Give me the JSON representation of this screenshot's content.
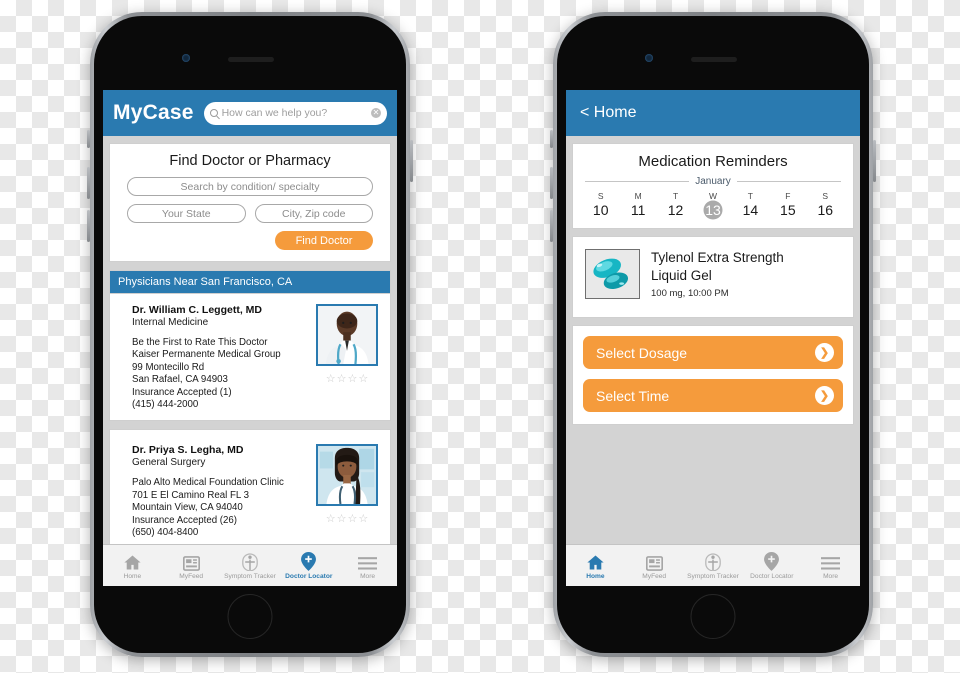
{
  "colors": {
    "brand_blue": "#2a7ab0",
    "accent_orange": "#f59b3c",
    "screen_bg": "#d3d3d3",
    "card_bg": "#ffffff",
    "muted_text": "#9a9a9a"
  },
  "left_phone": {
    "appbar": {
      "brand": "MyCase",
      "search_placeholder": "How can we help you?",
      "search_value": "",
      "search_icon": "search-icon",
      "clear_icon": "clear-icon"
    },
    "find_panel": {
      "title": "Find Doctor or Pharmacy",
      "condition_field": {
        "placeholder": "Search by condition/ specialty",
        "value": ""
      },
      "state_field": {
        "placeholder": "Your State",
        "value": ""
      },
      "zip_field": {
        "placeholder": "City, Zip code",
        "value": ""
      },
      "submit_label": "Find Doctor"
    },
    "results": {
      "banner": "Physicians Near San Francisco, CA",
      "doctors": [
        {
          "name": "Dr. William C. Leggett, MD",
          "specialty": "Internal Medicine",
          "rate_prompt": "Be the First to Rate This Doctor",
          "practice": "Kaiser Permanente Medical Group",
          "street": "99 Montecillo Rd",
          "city_state_zip": "San Rafael, CA 94903",
          "insurance": "Insurance Accepted (1)",
          "phone": "(415) 444-2000",
          "rating_stars": 0,
          "star_count": 4,
          "photo": "doctor-male-photo"
        },
        {
          "name": "Dr. Priya S. Legha, MD",
          "specialty": "General Surgery",
          "rate_prompt": "",
          "practice": "Palo Alto Medical Foundation Clinic",
          "street": "701 E El Camino Real FL 3",
          "city_state_zip": "Mountain View, CA 94040",
          "insurance": "Insurance Accepted (26)",
          "phone": "(650) 404-8400",
          "rating_stars": 0,
          "star_count": 4,
          "photo": "doctor-female-photo"
        }
      ]
    },
    "tabbar": {
      "active": "Doctor Locator",
      "items": [
        {
          "label": "Home",
          "icon": "home-icon"
        },
        {
          "label": "MyFeed",
          "icon": "feed-icon"
        },
        {
          "label": "Symptom Tracker",
          "icon": "body-icon"
        },
        {
          "label": "Doctor Locator",
          "icon": "map-pin-plus-icon"
        },
        {
          "label": "More",
          "icon": "hamburger-icon"
        }
      ]
    }
  },
  "right_phone": {
    "navbar": {
      "back_label": "< Home",
      "back_icon": "chevron-left-icon"
    },
    "reminders": {
      "title": "Medication Reminders",
      "month": "January",
      "weekday_labels": [
        "S",
        "M",
        "T",
        "W",
        "T",
        "F",
        "S"
      ],
      "days": [
        "10",
        "11",
        "12",
        "13",
        "14",
        "15",
        "16"
      ],
      "selected_day": "13"
    },
    "medication": {
      "image": "pill-capsules-photo",
      "name_line1": "Tylenol Extra Strength",
      "name_line2": "Liquid Gel",
      "details": "100 mg, 10:00 PM"
    },
    "actions": [
      {
        "label": "Select Dosage",
        "icon": "chevron-right-icon"
      },
      {
        "label": "Select Time",
        "icon": "chevron-right-icon"
      }
    ],
    "tabbar": {
      "active": "Home",
      "items": [
        {
          "label": "Home",
          "icon": "home-icon"
        },
        {
          "label": "MyFeed",
          "icon": "feed-icon"
        },
        {
          "label": "Symptom Tracker",
          "icon": "body-icon"
        },
        {
          "label": "Doctor Locator",
          "icon": "map-pin-plus-icon"
        },
        {
          "label": "More",
          "icon": "hamburger-icon"
        }
      ]
    }
  }
}
